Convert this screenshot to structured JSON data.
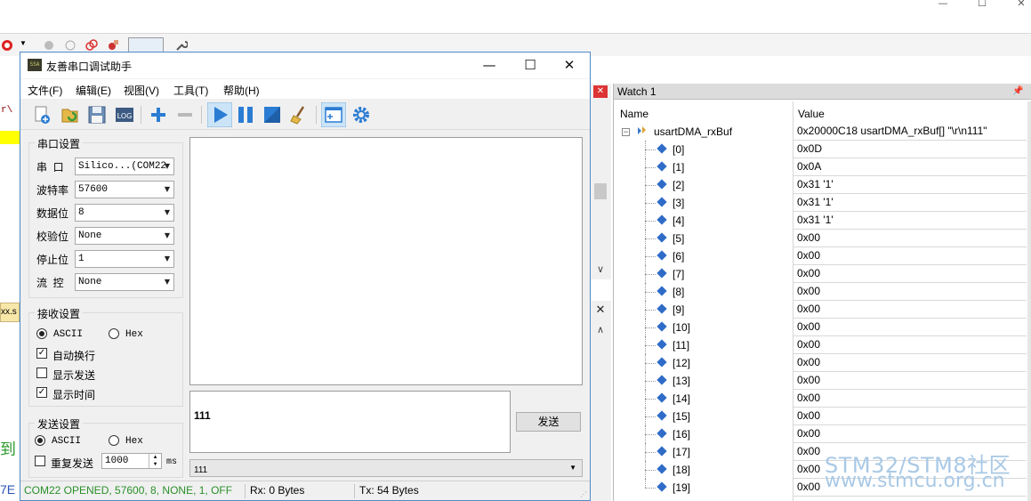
{
  "ide": {
    "left_code": "r\\",
    "left_tab": "xx.s",
    "left_text_green": "到",
    "left_text_blue": "7E"
  },
  "serial": {
    "title": "友善串口调试助手",
    "menu": [
      "文件(F)",
      "编辑(E)",
      "视图(V)",
      "工具(T)",
      "帮助(H)"
    ],
    "toolbar_icons": [
      "new-session-icon",
      "open-icon",
      "save-icon",
      "log-icon",
      "add-icon",
      "remove-icon",
      "start-icon",
      "pause-icon",
      "stop-icon",
      "clear-icon",
      "window-icon",
      "settings-icon"
    ],
    "port_settings": {
      "title": "串口设置",
      "port_label": "串  口",
      "port_value": "Silico...(COM22",
      "baud_label": "波特率",
      "baud_value": "57600",
      "data_label": "数据位",
      "data_value": "8",
      "parity_label": "校验位",
      "parity_value": "None",
      "stop_label": "停止位",
      "stop_value": "1",
      "flow_label": "流  控",
      "flow_value": "None"
    },
    "recv_settings": {
      "title": "接收设置",
      "ascii": "ASCII",
      "hex": "Hex",
      "auto_newline": "自动换行",
      "show_send": "显示发送",
      "show_time": "显示时间"
    },
    "send_settings": {
      "title": "发送设置",
      "ascii": "ASCII",
      "hex": "Hex",
      "repeat": "重复发送",
      "interval": "1000",
      "unit": "ms"
    },
    "send_text": "111",
    "send_button": "发送",
    "history_value": "111",
    "status": {
      "port": "COM22 OPENED, 57600, 8, NONE, 1, OFF",
      "rx": "Rx: 0 Bytes",
      "tx": "Tx: 54 Bytes"
    },
    "colors": {
      "status_green": "#2a8f2a",
      "accent_blue": "#2b7cd3"
    }
  },
  "watch": {
    "title": "Watch 1",
    "col_name": "Name",
    "col_value": "Value",
    "root": {
      "name": "usartDMA_rxBuf",
      "value": "0x20000C18 usartDMA_rxBuf[] \"\\r\\n111\""
    },
    "items": [
      {
        "name": "[0]",
        "value": "0x0D"
      },
      {
        "name": "[1]",
        "value": "0x0A"
      },
      {
        "name": "[2]",
        "value": "0x31 '1'"
      },
      {
        "name": "[3]",
        "value": "0x31 '1'"
      },
      {
        "name": "[4]",
        "value": "0x31 '1'"
      },
      {
        "name": "[5]",
        "value": "0x00"
      },
      {
        "name": "[6]",
        "value": "0x00"
      },
      {
        "name": "[7]",
        "value": "0x00"
      },
      {
        "name": "[8]",
        "value": "0x00"
      },
      {
        "name": "[9]",
        "value": "0x00"
      },
      {
        "name": "[10]",
        "value": "0x00"
      },
      {
        "name": "[11]",
        "value": "0x00"
      },
      {
        "name": "[12]",
        "value": "0x00"
      },
      {
        "name": "[13]",
        "value": "0x00"
      },
      {
        "name": "[14]",
        "value": "0x00"
      },
      {
        "name": "[15]",
        "value": "0x00"
      },
      {
        "name": "[16]",
        "value": "0x00"
      },
      {
        "name": "[17]",
        "value": "0x00"
      },
      {
        "name": "[18]",
        "value": "0x00"
      },
      {
        "name": "[19]",
        "value": "0x00"
      }
    ]
  },
  "watermark": {
    "line1": "STM32/STM8社区",
    "line2": "www.stmcu.org.cn"
  }
}
